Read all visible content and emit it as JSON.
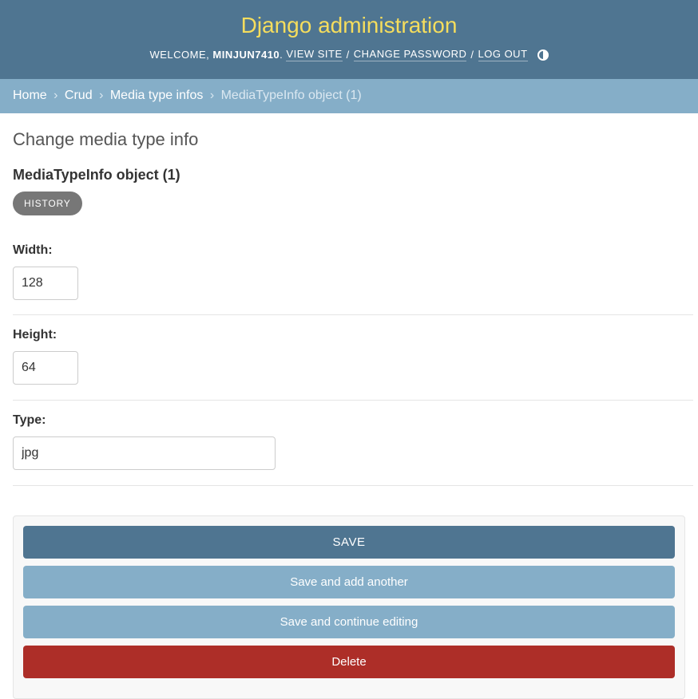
{
  "header": {
    "title": "Django administration",
    "welcome": "WELCOME,",
    "username": "MINJUN7410",
    "view_site": "VIEW SITE",
    "change_password": "CHANGE PASSWORD",
    "log_out": "LOG OUT",
    "separator": "/",
    "theme_icon": "contrast-half-circle-icon"
  },
  "breadcrumbs": {
    "home": "Home",
    "app": "Crud",
    "model": "Media type infos",
    "current": "MediaTypeInfo object (1)",
    "arrow": "›"
  },
  "page": {
    "title": "Change media type info",
    "object_title": "MediaTypeInfo object (1)",
    "history_label": "HISTORY"
  },
  "fields": {
    "width": {
      "label": "Width:",
      "value": "128"
    },
    "height": {
      "label": "Height:",
      "value": "64"
    },
    "type": {
      "label": "Type:",
      "value": "jpg"
    }
  },
  "actions": {
    "save": "SAVE",
    "save_add_another": "Save and add another",
    "save_continue": "Save and continue editing",
    "delete": "Delete"
  },
  "colors": {
    "header_bg": "#4f7591",
    "branding": "#f5dd5d",
    "breadcrumb_bg": "#85aec8",
    "delete": "#ad2e28"
  }
}
